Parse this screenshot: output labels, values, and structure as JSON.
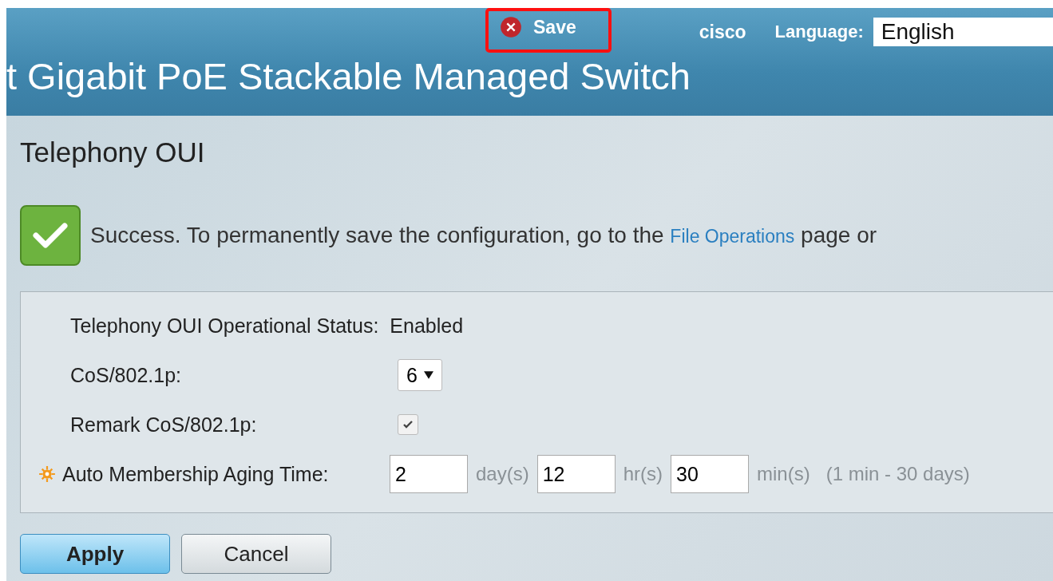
{
  "header": {
    "title": "t Gigabit PoE Stackable Managed Switch",
    "save": {
      "label": "Save",
      "highlighted": true
    },
    "user": "cisco",
    "language_label": "Language:",
    "language_value": "English"
  },
  "page_title": "Telephony OUI",
  "message": {
    "kind": "success",
    "text_before": "Success. To permanently save the configuration, go to the",
    "link": "File Operations",
    "text_after": "page or"
  },
  "status": {
    "label": "Telephony OUI Operational Status:",
    "value": "Enabled"
  },
  "cos": {
    "label": "CoS/802.1p:",
    "value": "6"
  },
  "remark": {
    "label": "Remark CoS/802.1p:",
    "checked": true
  },
  "aging": {
    "label": "Auto Membership Aging Time:",
    "required": true,
    "fields": [
      {
        "value": "2",
        "unit": "day(s)"
      },
      {
        "value": "12",
        "unit": "hr(s)"
      },
      {
        "value": "30",
        "unit": "min(s)"
      }
    ],
    "hint": "(1 min - 30 days)"
  },
  "buttons": [
    {
      "label": "Apply",
      "primary": true
    },
    {
      "label": "Cancel",
      "primary": false
    }
  ]
}
